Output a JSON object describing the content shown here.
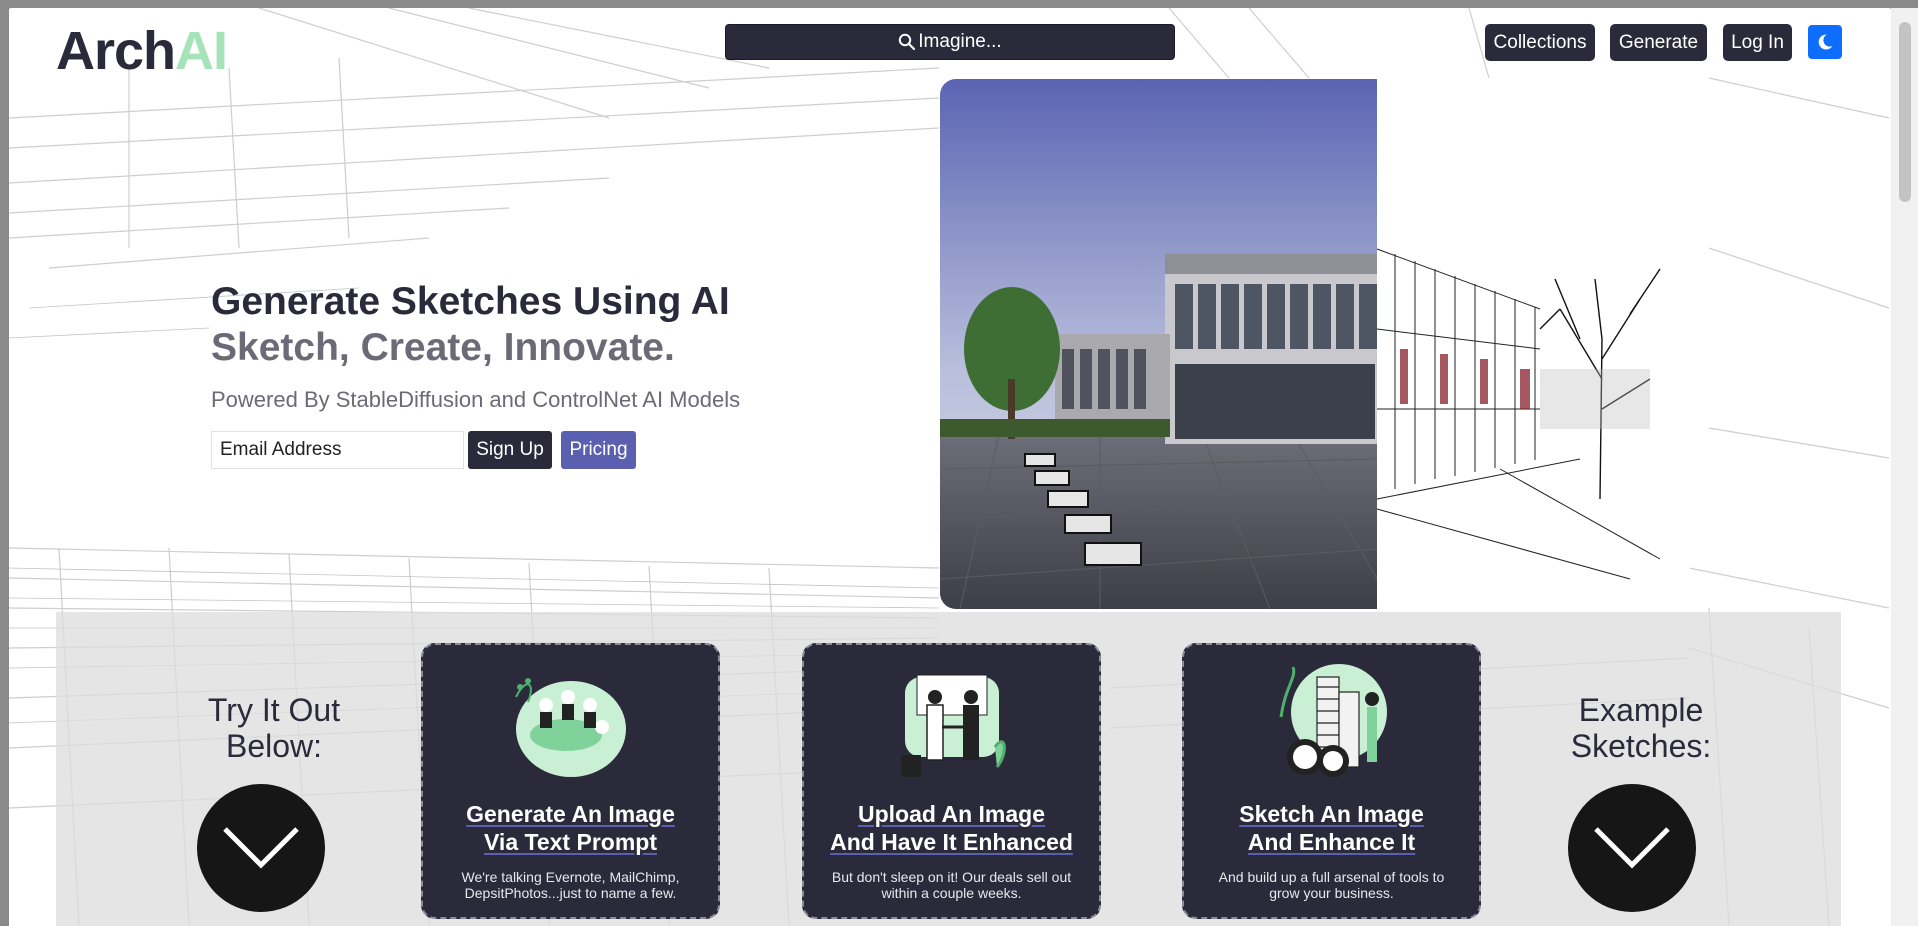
{
  "brand": {
    "logo_part1": "Arch",
    "logo_part2": "AI"
  },
  "header": {
    "search_placeholder": "Imagine...",
    "nav": {
      "collections": "Collections",
      "generate": "Generate",
      "login": "Log In"
    },
    "theme_icon": "moon-icon"
  },
  "hero": {
    "title": "Generate Sketches Using AI",
    "subtitle": "Sketch, Create, Innovate.",
    "powered_by": "Powered By StableDiffusion and ControlNet AI Models",
    "email_placeholder": "Email Address",
    "signup_label": "Sign Up",
    "pricing_label": "Pricing"
  },
  "features": {
    "left_label": "Try It Out Below:",
    "right_label": "Example Sketches:",
    "cards": [
      {
        "title_line1": "Generate An Image",
        "title_line2": "Via Text Prompt",
        "desc": "We're talking Evernote, MailChimp, DepsitPhotos...just to name a few."
      },
      {
        "title_line1": "Upload An Image",
        "title_line2": "And Have It Enhanced",
        "desc": "But don't sleep on it! Our deals sell out within a couple weeks."
      },
      {
        "title_line1": "Sketch An Image",
        "title_line2": "And Enhance It",
        "desc": "And build up a full arsenal of tools to grow your business."
      }
    ]
  },
  "colors": {
    "dark": "#2b2a3b",
    "accent_green": "#a7e3b8",
    "pricing": "#5a5fb0",
    "theme_button": "#0d6efd"
  }
}
